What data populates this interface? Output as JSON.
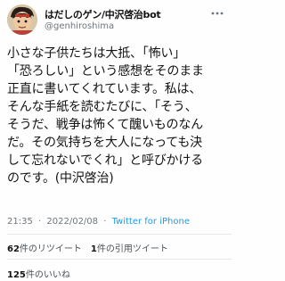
{
  "user": {
    "display_name": "はだしのゲン/中沢啓治bot",
    "handle": "@genhiroshima"
  },
  "tweet": {
    "lines": [
      "小さな子供たちは大抵、「怖い」",
      "「恐ろしい」という感想をそのまま",
      "正直に書いてくれています。私は、",
      "そんな手紙を読むたびに、「そう、",
      "そうだ、戦争は怖くて醜いものなん",
      "だ。その気持ちを大人になっても決",
      "して忘れないでくれ」と呼びかける",
      "のです。(中沢啓治)"
    ]
  },
  "meta": {
    "time": "21:35",
    "separator": "·",
    "date": "2022/02/08",
    "app": "Twitter for iPhone"
  },
  "stats": {
    "retweets_count": "62",
    "retweets_label": "件のリツイート",
    "quotes_count": "1",
    "quotes_label": "件の引用ツイート",
    "likes_count": "125",
    "likes_label": "件のいいね"
  },
  "icons": {
    "more": "more-icon"
  }
}
